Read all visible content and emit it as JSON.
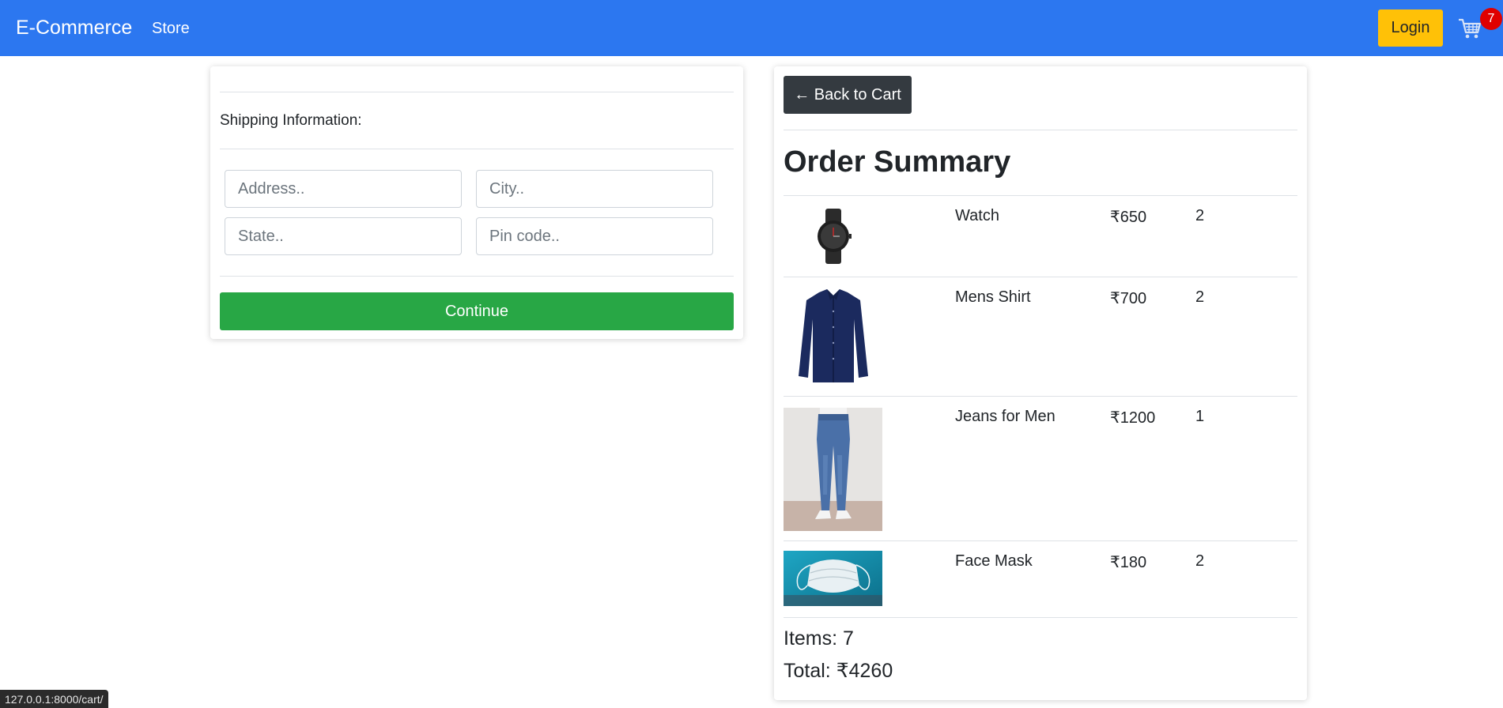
{
  "navbar": {
    "brand": "E-Commerce",
    "links": [
      "Store"
    ],
    "login_label": "Login",
    "cart_icon": "cart-icon",
    "cart_count": "7",
    "bg_color": "#2c77f0",
    "login_color": "#ffc107"
  },
  "shipping": {
    "label": "Shipping Information:",
    "address_placeholder": "Address..",
    "city_placeholder": "City..",
    "state_placeholder": "State..",
    "pincode_placeholder": "Pin code..",
    "continue_label": "Continue",
    "continue_color": "#28a745"
  },
  "summary": {
    "back_label": "← Back to Cart",
    "title": "Order Summary",
    "items": [
      {
        "name": "Watch",
        "price": "₹650",
        "qty": "2",
        "image": "watch"
      },
      {
        "name": "Mens Shirt",
        "price": "₹700",
        "qty": "2",
        "image": "shirt"
      },
      {
        "name": "Jeans for Men",
        "price": "₹1200",
        "qty": "1",
        "image": "jeans"
      },
      {
        "name": "Face Mask",
        "price": "₹180",
        "qty": "2",
        "image": "face-mask"
      }
    ],
    "items_label": "Items: 7",
    "total_label": "Total:  ₹4260"
  },
  "status_bar": {
    "url": "127.0.0.1:8000/cart/"
  }
}
